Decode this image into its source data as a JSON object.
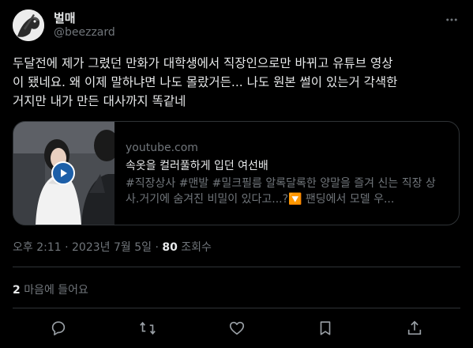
{
  "tweet": {
    "author_name": "벌매",
    "author_handle": "@beezzard",
    "text": "두달전에 제가 그렸던 만화가 대학생에서 직장인으로만 바뀌고 유튜브 영상\n이 됐네요. 왜 이제 말하냐면 나도 몰랐거든... 나도 원본 썰이 있는거 각색한\n거지만 내가 만든 대사까지 똑같네",
    "card": {
      "domain": "youtube.com",
      "title": "속옷을 컬러풀하게 입던 여선배",
      "description": "#직장상사 #맨발 #밀크필름 알록달록한 양말을 즐겨 신는 직장 상사.거기에 숨겨진 비밀이 있다고...?🔽 팬딩에서 모델 우..."
    },
    "time": "오후 2:11",
    "date": "2023년 7월 5일",
    "view_count": "80",
    "view_label": "조회수",
    "like_count": "2",
    "like_label": "마음에 들어요"
  },
  "icons": {
    "more": "more-horizontal-icon",
    "reply": "reply-icon",
    "retweet": "retweet-icon",
    "like": "heart-icon",
    "bookmark": "bookmark-icon",
    "share": "share-icon"
  },
  "colors": {
    "background": "#000000",
    "text": "#e7e9ea",
    "muted": "#71767b",
    "border": "#2f3336"
  }
}
